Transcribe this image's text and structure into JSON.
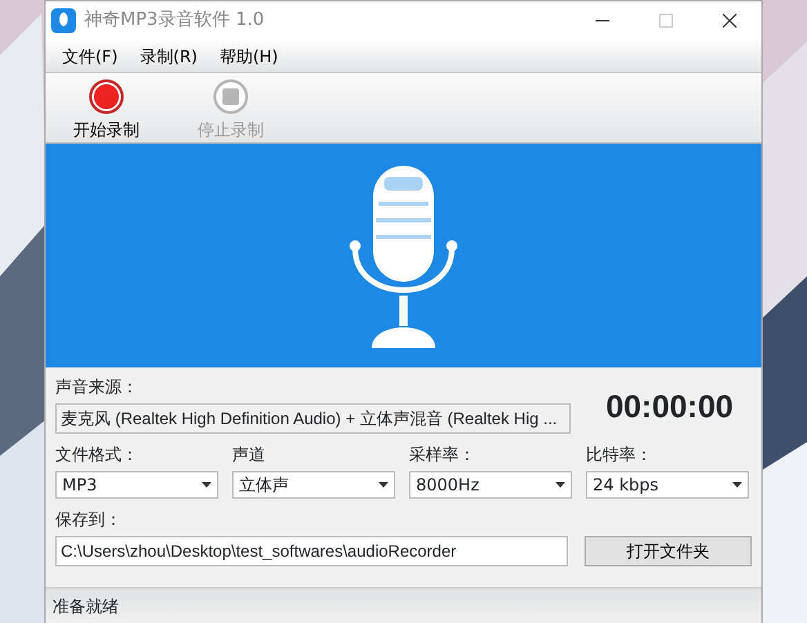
{
  "window": {
    "title": "神奇MP3录音软件 1.0"
  },
  "menu": [
    {
      "label": "文件(F)"
    },
    {
      "label": "录制(R)"
    },
    {
      "label": "帮助(H)"
    }
  ],
  "toolbar": [
    {
      "label": "开始录制",
      "kind": "record",
      "disabled": false
    },
    {
      "label": "停止录制",
      "kind": "stop",
      "disabled": true
    }
  ],
  "source": {
    "label": "声音来源：",
    "value": "麦克风 (Realtek High Definition Audio) + 立体声混音 (Realtek Hig ..."
  },
  "timer": "00:00:00",
  "settings": [
    {
      "label": "文件格式：",
      "value": "MP3"
    },
    {
      "label": "声道",
      "value": "立体声"
    },
    {
      "label": "采样率：",
      "value": "8000Hz"
    },
    {
      "label": "比特率：",
      "value": "24 kbps"
    }
  ],
  "save": {
    "label": "保存到：",
    "value": "C:\\Users\\zhou\\Desktop\\test_softwares\\audioRecorder",
    "button": "打开文件夹"
  },
  "status_bar": "准备就绪"
}
